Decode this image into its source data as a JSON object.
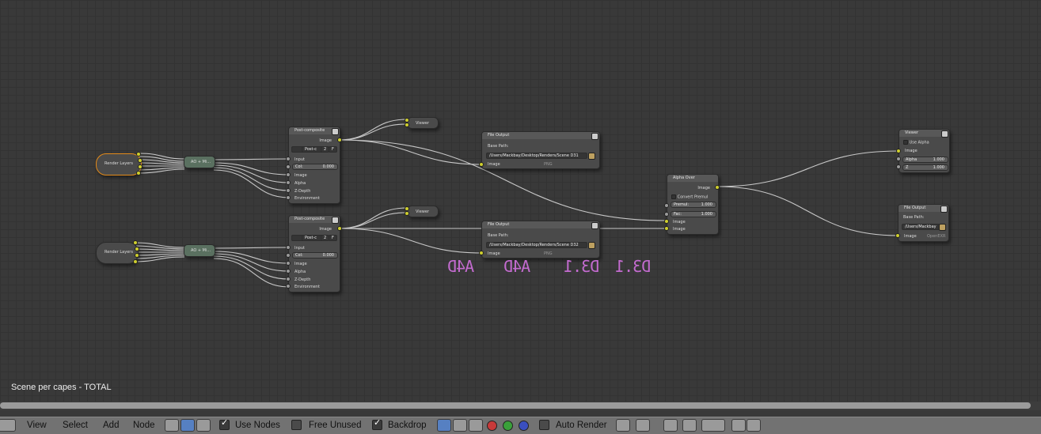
{
  "window": {
    "scene_label": "Scene per capes - TOTAL"
  },
  "nodes": {
    "render1": {
      "title": "Render Layers"
    },
    "render2": {
      "title": "Render Layers"
    },
    "mix1": {
      "title": "AO + Mi..."
    },
    "mix2": {
      "title": "AO + Mi..."
    },
    "post1": {
      "title": "Post-composite",
      "out_image": "Image",
      "name_field": "Post-c",
      "users": "2",
      "flag": "F",
      "sockets": [
        "Input",
        "Image",
        "Alpha",
        "Z-Depth",
        "Environment"
      ],
      "col_label": "Col:",
      "col_value": "0.000"
    },
    "post2": {
      "title": "Post-composite",
      "out_image": "Image",
      "name_field": "Post-c",
      "users": "2",
      "flag": "F",
      "sockets": [
        "Input",
        "Image",
        "Alpha",
        "Z-Depth",
        "Environment"
      ],
      "col_label": "Col:",
      "col_value": "0.000"
    },
    "viewer1": {
      "title": "Viewer"
    },
    "viewer2": {
      "title": "Viewer"
    },
    "file1": {
      "title": "File Output",
      "base_label": "Base Path:",
      "path": "/Users/Mackbay/Desktop/Renders/Scene D31",
      "in_image": "Image",
      "format": "PNG"
    },
    "file2": {
      "title": "File Output",
      "base_label": "Base Path:",
      "path": "/Users/Mackbay/Desktop/Renders/Scene D32",
      "in_image": "Image",
      "format": "PNG"
    },
    "alphaover": {
      "title": "Alpha Over",
      "out_image": "Image",
      "convert": "Convert Premul",
      "premul_label": "Premul:",
      "premul_value": "1.000",
      "fac_label": "Fac:",
      "fac_value": "1.000",
      "in1": "Image",
      "in2": "Image"
    },
    "viewer3": {
      "title": "Viewer",
      "use_alpha": "Use Alpha",
      "in_image": "Image",
      "alpha_label": "Alpha",
      "alpha_value": "1.000",
      "z_label": "Z",
      "z_value": "1.000"
    },
    "file3": {
      "title": "File Output",
      "base_label": "Base Path:",
      "path": "/Users/Mackbay",
      "in_image": "Image",
      "format": "OpenEXR"
    }
  },
  "ghost_text": [
    "A4D",
    "A4D",
    "D3.1",
    "D3.1"
  ],
  "header": {
    "menu": [
      "View",
      "Select",
      "Add",
      "Node"
    ],
    "use_nodes": {
      "label": "Use Nodes",
      "checked": true
    },
    "free_unused": {
      "label": "Free Unused",
      "checked": false
    },
    "backdrop": {
      "label": "Backdrop",
      "checked": true
    },
    "auto_render": {
      "label": "Auto Render",
      "checked": false
    },
    "channel_colors": [
      "#c83a3a",
      "#3aa03a",
      "#3a4fc0"
    ]
  },
  "icons": [
    "editor-type-icon",
    "shader-icon",
    "compositor-icon",
    "texture-icon",
    "backdrop-rgb-icon",
    "backdrop-checker-icon",
    "backdrop-alpha-icon",
    "pin-icon",
    "parent-icon",
    "snap-icon",
    "copy-icon",
    "paste-icon"
  ]
}
